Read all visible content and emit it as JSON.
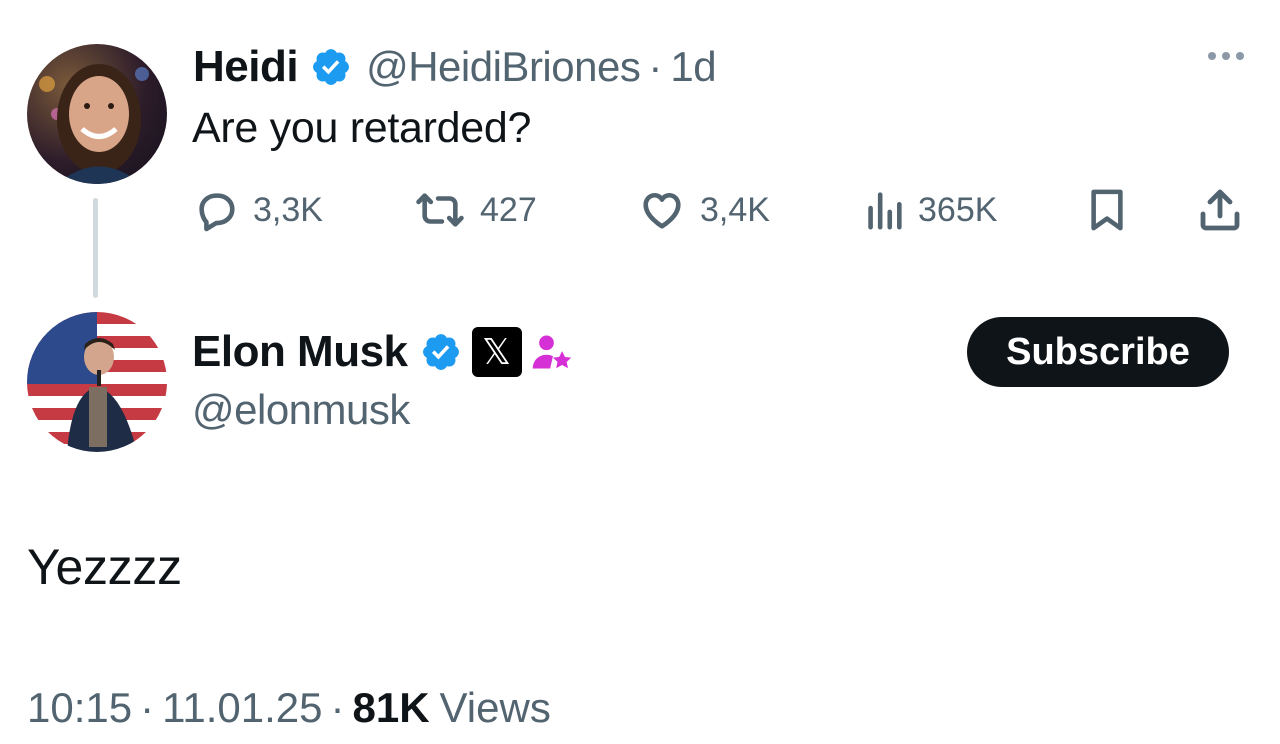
{
  "reply_to": {
    "name": "Heidi",
    "handle": "@HeidiBriones",
    "time": "1d",
    "text": "Are you retarded?",
    "stats": {
      "replies": "3,3K",
      "reposts": "427",
      "likes": "3,4K",
      "views": "365K"
    }
  },
  "tweet": {
    "name": "Elon Musk",
    "handle": "@elonmusk",
    "affiliation_badge": "𝕏",
    "subscribe_label": "Subscribe",
    "text": "Yezzzz",
    "time": "10:15",
    "date": "11.01.25",
    "views_count": "81K",
    "views_label": "Views"
  },
  "separator": "·",
  "colors": {
    "verified": "#1d9bf0",
    "secondary_text": "#536471",
    "subscriber_icon": "#d52fd6",
    "button_bg": "#0f1419"
  },
  "icons": [
    "verified-badge-icon",
    "more-icon",
    "reply-icon",
    "repost-icon",
    "like-icon",
    "views-icon",
    "bookmark-icon",
    "share-icon",
    "x-logo-icon",
    "subscriber-icon"
  ]
}
